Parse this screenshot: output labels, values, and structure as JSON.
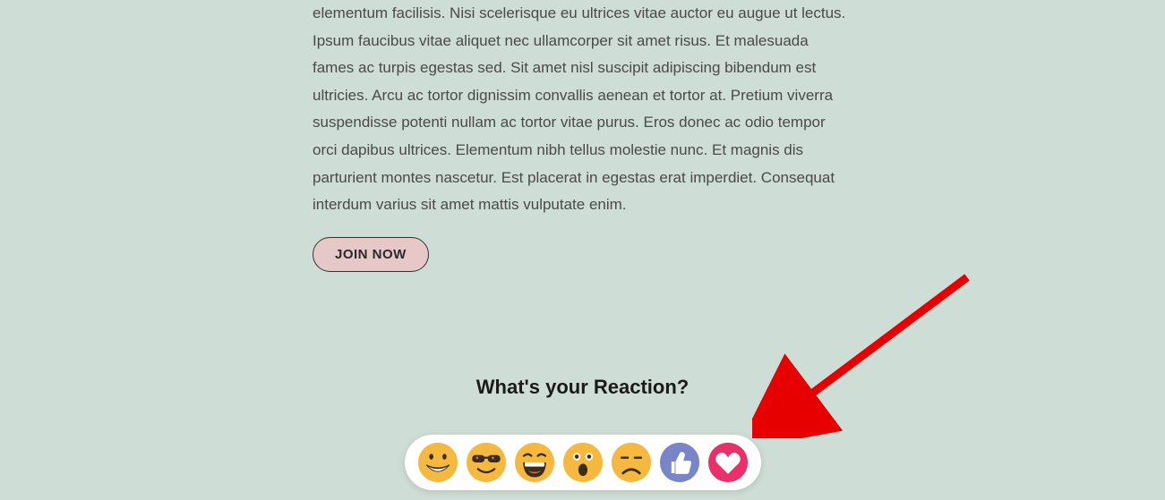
{
  "article": {
    "body": "elementum facilisis. Nisi scelerisque eu ultrices vitae auctor eu augue ut lectus. Ipsum faucibus vitae aliquet nec ullamcorper sit amet risus. Et malesuada fames ac turpis egestas sed. Sit amet nisl suscipit adipiscing bibendum est ultricies. Arcu ac tortor dignissim convallis aenean et tortor at. Pretium viverra suspendisse potenti nullam ac tortor vitae purus. Eros donec ac odio tempor orci dapibus ultrices. Elementum nibh tellus molestie nunc. Et magnis dis parturient montes nascetur. Est placerat in egestas erat imperdiet. Consequat interdum varius sit amet mattis vulputate enim.",
    "cta_label": "JOIN NOW"
  },
  "reactions": {
    "title": "What's your Reaction?",
    "items": [
      {
        "name": "smile"
      },
      {
        "name": "cool"
      },
      {
        "name": "laugh"
      },
      {
        "name": "wow"
      },
      {
        "name": "sad"
      },
      {
        "name": "like"
      },
      {
        "name": "love"
      }
    ]
  },
  "annotation": {
    "arrow_color": "#e60000"
  }
}
